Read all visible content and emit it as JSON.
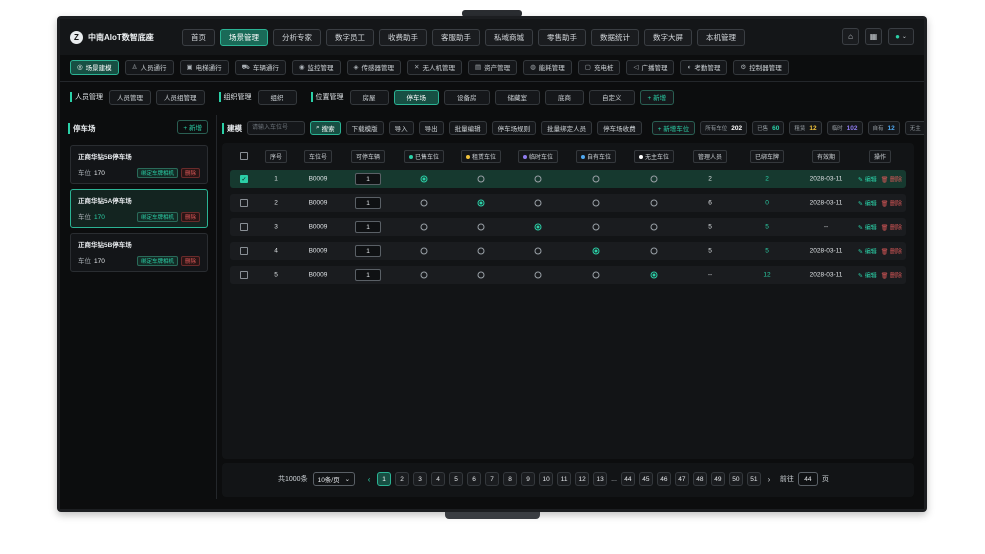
{
  "app": {
    "logo_glyph": "Z",
    "name": "中南AIoT数智底座"
  },
  "topnav": {
    "items": [
      "首页",
      "场景管理",
      "分析专家",
      "数字员工",
      "收费助手",
      "客服助手",
      "私域商城",
      "零售助手",
      "数据统计",
      "数字大屏",
      "本机管理"
    ],
    "active_index": 1
  },
  "top_icons": {
    "monitor_icon": "⌂",
    "layers_icon": "▦",
    "user_icon": "●",
    "chevron": "⌄"
  },
  "subnav": {
    "items": [
      {
        "icon": "◎",
        "label": "场景建模"
      },
      {
        "icon": "♙",
        "label": "人员通行"
      },
      {
        "icon": "▣",
        "label": "电梯通行"
      },
      {
        "icon": "⛟",
        "label": "车辆通行"
      },
      {
        "icon": "◉",
        "label": "监控管理"
      },
      {
        "icon": "◈",
        "label": "传感器管理"
      },
      {
        "icon": "✕",
        "label": "无人机管理"
      },
      {
        "icon": "▤",
        "label": "资产管理"
      },
      {
        "icon": "◍",
        "label": "能耗管理"
      },
      {
        "icon": "▢",
        "label": "充电桩"
      },
      {
        "icon": "◁",
        "label": "广播管理"
      },
      {
        "icon": "◐",
        "label": "考勤管理"
      },
      {
        "icon": "⚙",
        "label": "控制器管理"
      }
    ],
    "active_index": 0
  },
  "filters": {
    "group1_label": "人员管理",
    "group1_items": [
      "人员管理",
      "人员组管理"
    ],
    "group2_label": "组织管理",
    "group2_items": [
      "组织"
    ],
    "group3_label": "位置管理",
    "group3_items": [
      "房屋",
      "停车场",
      "设备房",
      "储藏室",
      "底商",
      "自定义"
    ],
    "group3_active": 1,
    "add_label": "+ 新增"
  },
  "left_panel": {
    "title": "停车场",
    "add_label": "+ 新增",
    "lots": [
      {
        "name": "正商华钻5B停车场",
        "spaces_label": "车位",
        "spaces": "170",
        "bind_label": "绑定车牌相机",
        "delete_label": "删除",
        "selected": false
      },
      {
        "name": "正商华钻5A停车场",
        "spaces_label": "车位",
        "spaces": "170",
        "bind_label": "绑定车牌相机",
        "delete_label": "删除",
        "selected": true
      },
      {
        "name": "正商华钻5B停车场",
        "spaces_label": "车位",
        "spaces": "170",
        "bind_label": "绑定车牌相机",
        "delete_label": "删除",
        "selected": false
      }
    ]
  },
  "toolbar": {
    "title": "建模",
    "search_placeholder": "请输入车位号",
    "search_label": "搜索",
    "buttons": [
      "下载模版",
      "导入",
      "导出",
      "批量编辑",
      "停车场规则",
      "批量绑定人员",
      "停车场收费"
    ],
    "add_space_label": "+ 新增车位",
    "stats": [
      {
        "label": "所有车位",
        "value": "202",
        "color": "#ffffff"
      },
      {
        "label": "已售",
        "value": "60",
        "color": "#2bd0a7"
      },
      {
        "label": "租赁",
        "value": "12",
        "color": "#f0c23b"
      },
      {
        "label": "临时",
        "value": "102",
        "color": "#8f7cf0"
      },
      {
        "label": "自有",
        "value": "12",
        "color": "#4fa8f0"
      },
      {
        "label": "无主",
        "value": "10",
        "color": "#ffffff"
      }
    ]
  },
  "table": {
    "headers": [
      "序号",
      "车位号",
      "可停车辆",
      "已售车位",
      "租赁车位",
      "临时车位",
      "自有车位",
      "无主车位",
      "管理人员",
      "已绑车牌",
      "有效期",
      "操作"
    ],
    "type_colors": [
      "#2bd0a7",
      "#f0c23b",
      "#8f7cf0",
      "#4fa8f0",
      "#ffffff"
    ],
    "edit_label": "编辑",
    "delete_label": "删除",
    "rows": [
      {
        "no": "1",
        "space": "B0009",
        "qty": "1",
        "type": 0,
        "manager": "2",
        "plates": "2",
        "expiry": "2028-03-11",
        "checked": true
      },
      {
        "no": "2",
        "space": "B0009",
        "qty": "1",
        "type": 1,
        "manager": "6",
        "plates": "0",
        "expiry": "2028-03-11",
        "checked": false
      },
      {
        "no": "3",
        "space": "B0009",
        "qty": "1",
        "type": 2,
        "manager": "5",
        "plates": "5",
        "expiry": "--",
        "checked": false
      },
      {
        "no": "4",
        "space": "B0009",
        "qty": "1",
        "type": 3,
        "manager": "5",
        "plates": "5",
        "expiry": "2028-03-11",
        "checked": false
      },
      {
        "no": "5",
        "space": "B0009",
        "qty": "1",
        "type": 4,
        "manager": "--",
        "plates": "12",
        "expiry": "2028-03-11",
        "checked": false
      }
    ]
  },
  "pagination": {
    "total": "共1000条",
    "page_size": "10条/页",
    "pages_a": [
      "1",
      "2",
      "3",
      "4",
      "5",
      "6",
      "7",
      "8",
      "9",
      "10",
      "11",
      "12",
      "13"
    ],
    "ellipsis": "...",
    "pages_b": [
      "44",
      "45",
      "46",
      "47",
      "48",
      "49",
      "50",
      "51"
    ],
    "current": "1",
    "goto_label": "前往",
    "goto_value": "44",
    "unit": "页"
  }
}
